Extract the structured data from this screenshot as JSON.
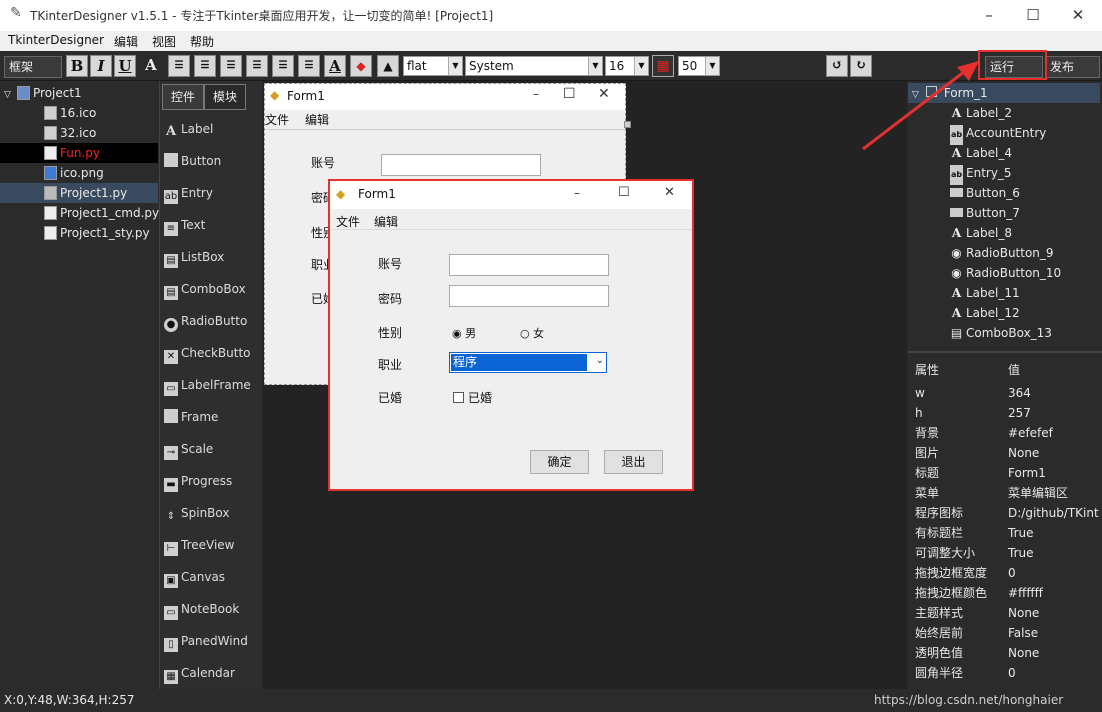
{
  "window": {
    "title": "TKinterDesigner v1.5.1 - 专注于Tkinter桌面应用开发，让一切变的简单!    [Project1]"
  },
  "menubar": [
    "TkinterDesigner",
    "编辑",
    "视图",
    "帮助"
  ],
  "toolbar": {
    "frame_label": "框架",
    "bold": "B",
    "italic": "I",
    "underline": "U",
    "font_a": "A",
    "relief": "flat",
    "font_family": "System",
    "font_size": "16",
    "grid_size": "50",
    "run": "运行",
    "publish": "发布"
  },
  "project_tree": [
    {
      "label": "Project1",
      "icon": "project-icon"
    },
    {
      "label": "16.ico",
      "icon": "file-icon"
    },
    {
      "label": "32.ico",
      "icon": "file-icon"
    },
    {
      "label": "Fun.py",
      "icon": "python-file-icon"
    },
    {
      "label": "ico.png",
      "icon": "image-file-icon"
    },
    {
      "label": "Project1.py",
      "icon": "form-file-icon"
    },
    {
      "label": "Project1_cmd.py",
      "icon": "python-file-icon"
    },
    {
      "label": "Project1_sty.py",
      "icon": "python-file-icon"
    }
  ],
  "toolbox": {
    "tabs": [
      "控件",
      "模块"
    ],
    "widgets": [
      "Label",
      "Button",
      "Entry",
      "Text",
      "ListBox",
      "ComboBox",
      "RadioButto",
      "CheckButto",
      "LabelFrame",
      "Frame",
      "Scale",
      "Progress",
      "SpinBox",
      "TreeView",
      "Canvas",
      "NoteBook",
      "PanedWind",
      "Calendar"
    ]
  },
  "design_form": {
    "title": "Form1",
    "menu": [
      "文件",
      "编辑"
    ],
    "labels": [
      "账号",
      "密码",
      "性别",
      "职业",
      "已婚"
    ]
  },
  "run_form": {
    "title": "Form1",
    "menu": [
      "文件",
      "编辑"
    ],
    "account_label": "账号",
    "password_label": "密码",
    "gender_label": "性别",
    "gender_male": "男",
    "gender_female": "女",
    "job_label": "职业",
    "job_value": "程序",
    "married_label": "已婚",
    "married_check": "已婚",
    "ok_button": "确定",
    "exit_button": "退出"
  },
  "component_tree": [
    {
      "label": "Form_1",
      "icon": "form-icon"
    },
    {
      "label": "Label_2",
      "icon": "label-icon"
    },
    {
      "label": "AccountEntry",
      "icon": "entry-icon"
    },
    {
      "label": "Label_4",
      "icon": "label-icon"
    },
    {
      "label": "Entry_5",
      "icon": "entry-icon"
    },
    {
      "label": "Button_6",
      "icon": "button-icon"
    },
    {
      "label": "Button_7",
      "icon": "button-icon"
    },
    {
      "label": "Label_8",
      "icon": "label-icon"
    },
    {
      "label": "RadioButton_9",
      "icon": "radio-icon"
    },
    {
      "label": "RadioButton_10",
      "icon": "radio-icon"
    },
    {
      "label": "Label_11",
      "icon": "label-icon"
    },
    {
      "label": "Label_12",
      "icon": "label-icon"
    },
    {
      "label": "ComboBox_13",
      "icon": "combobox-icon"
    }
  ],
  "properties": {
    "header_key": "属性",
    "header_value": "值",
    "rows": [
      [
        "w",
        "364"
      ],
      [
        "h",
        "257"
      ],
      [
        "背景",
        "#efefef"
      ],
      [
        "图片",
        "None"
      ],
      [
        "标题",
        "Form1"
      ],
      [
        "菜单",
        "菜单编辑区"
      ],
      [
        "程序图标",
        "D:/github/TKint"
      ],
      [
        "有标题栏",
        "True"
      ],
      [
        "可调整大小",
        "True"
      ],
      [
        "拖拽边框宽度",
        "0"
      ],
      [
        "拖拽边框颜色",
        "#ffffff"
      ],
      [
        "主题样式",
        "None"
      ],
      [
        "始终居前",
        "False"
      ],
      [
        "透明色值",
        "None"
      ],
      [
        "圆角半径",
        "0"
      ]
    ]
  },
  "status": "X:0,Y:48,W:364,H:257",
  "watermark": "https://blog.csdn.net/honghaier",
  "colors": {
    "highlight": "#e53030",
    "selection": "#3a4a5e",
    "combo_selected": "#0a64d4"
  }
}
